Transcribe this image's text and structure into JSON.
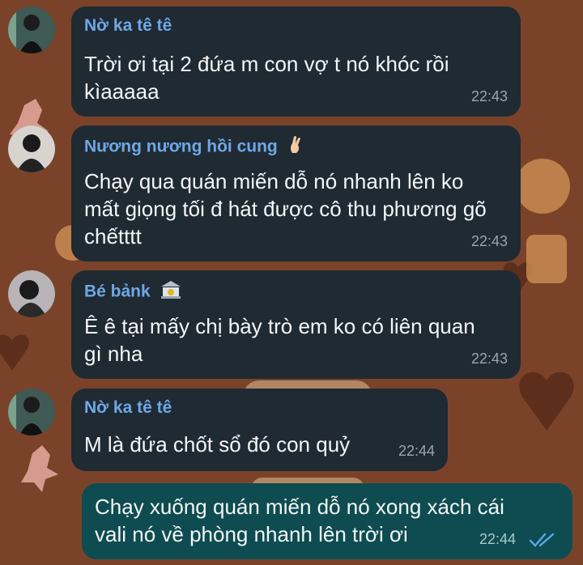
{
  "colors": {
    "wallpaper": "#7a4329",
    "bubble_incoming": "#1f2a33",
    "bubble_outgoing": "#0e4c51",
    "sender_name": "#6fa8e6",
    "timestamp": "#9aa6ae",
    "read_check": "#5aa9e6"
  },
  "messages": [
    {
      "sender": "Nờ ka tê tê",
      "text": "Trời ơi tại 2 đứa m con vợ t nó khóc rồi\nkìaaaaa",
      "time": "22:43"
    },
    {
      "sender": "Nương nương hồi cung",
      "sender_emoji": "crossed-fingers-icon",
      "text": "Chạy qua quán miến dỗ nó nhanh lên ko\nmất giọng tối đ hát được cô thu phương gõ\nchếtttt",
      "time": "22:43"
    },
    {
      "sender": "Bé bảnk",
      "sender_emoji": "bank-icon",
      "text": "Ê ê tại mấy chị bày trò em ko có liên quan\ngì nha",
      "time": "22:43"
    },
    {
      "sender": "Nờ ka tê tê",
      "text": "M là đứa chốt sổ đó con quỷ",
      "time": "22:44"
    }
  ],
  "outgoing": {
    "text": "Chạy xuống quán miến dỗ nó xong xách cái\nvali nó về phòng nhanh lên trời ơi",
    "time": "22:44",
    "status_icon": "double-check-icon"
  }
}
